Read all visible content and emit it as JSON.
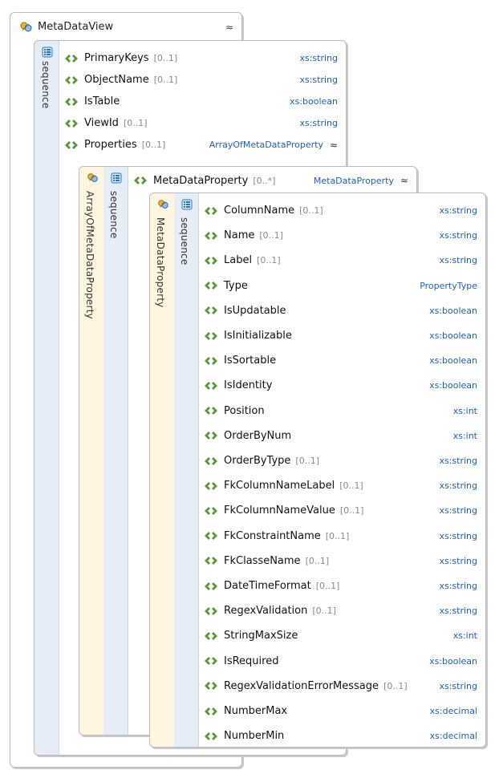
{
  "root": {
    "title": "MetaDataView",
    "collapse_glyph": "≈",
    "sequence_label": "sequence",
    "elements": [
      {
        "name": "PrimaryKeys",
        "mult": "[0..1]",
        "type": "xs:string"
      },
      {
        "name": "ObjectName",
        "mult": "[0..1]",
        "type": "xs:string"
      },
      {
        "name": "IsTable",
        "mult": "",
        "type": "xs:boolean"
      },
      {
        "name": "ViewId",
        "mult": "[0..1]",
        "type": "xs:string"
      },
      {
        "name": "Properties",
        "mult": "[0..1]",
        "type": "ArrayOfMetaDataProperty",
        "collapse_glyph": "≈"
      }
    ]
  },
  "array": {
    "complex_label": "ArrayOfMetaDataProperty",
    "sequence_label": "sequence",
    "header_element": {
      "name": "MetaDataProperty",
      "mult": "[0..*]",
      "type": "MetaDataProperty",
      "collapse_glyph": "≈"
    }
  },
  "meta": {
    "complex_label": "MetaDataProperty",
    "sequence_label": "sequence",
    "elements": [
      {
        "name": "ColumnName",
        "mult": "[0..1]",
        "type": "xs:string"
      },
      {
        "name": "Name",
        "mult": "[0..1]",
        "type": "xs:string"
      },
      {
        "name": "Label",
        "mult": "[0..1]",
        "type": "xs:string"
      },
      {
        "name": "Type",
        "mult": "",
        "type": "PropertyType"
      },
      {
        "name": "IsUpdatable",
        "mult": "",
        "type": "xs:boolean"
      },
      {
        "name": "IsInitializable",
        "mult": "",
        "type": "xs:boolean"
      },
      {
        "name": "IsSortable",
        "mult": "",
        "type": "xs:boolean"
      },
      {
        "name": "IsIdentity",
        "mult": "",
        "type": "xs:boolean"
      },
      {
        "name": "Position",
        "mult": "",
        "type": "xs:int"
      },
      {
        "name": "OrderByNum",
        "mult": "",
        "type": "xs:int"
      },
      {
        "name": "OrderByType",
        "mult": "[0..1]",
        "type": "xs:string"
      },
      {
        "name": "FkColumnNameLabel",
        "mult": "[0..1]",
        "type": "xs:string"
      },
      {
        "name": "FkColumnNameValue",
        "mult": "[0..1]",
        "type": "xs:string"
      },
      {
        "name": "FkConstraintName",
        "mult": "[0..1]",
        "type": "xs:string"
      },
      {
        "name": "FkClasseName",
        "mult": "[0..1]",
        "type": "xs:string"
      },
      {
        "name": "DateTimeFormat",
        "mult": "[0..1]",
        "type": "xs:string"
      },
      {
        "name": "RegexValidation",
        "mult": "[0..1]",
        "type": "xs:string"
      },
      {
        "name": "StringMaxSize",
        "mult": "",
        "type": "xs:int"
      },
      {
        "name": "IsRequired",
        "mult": "",
        "type": "xs:boolean"
      },
      {
        "name": "RegexValidationErrorMessage",
        "mult": "[0..1]",
        "type": "xs:string"
      },
      {
        "name": "NumberMax",
        "mult": "",
        "type": "xs:decimal"
      },
      {
        "name": "NumberMin",
        "mult": "",
        "type": "xs:decimal"
      }
    ]
  }
}
